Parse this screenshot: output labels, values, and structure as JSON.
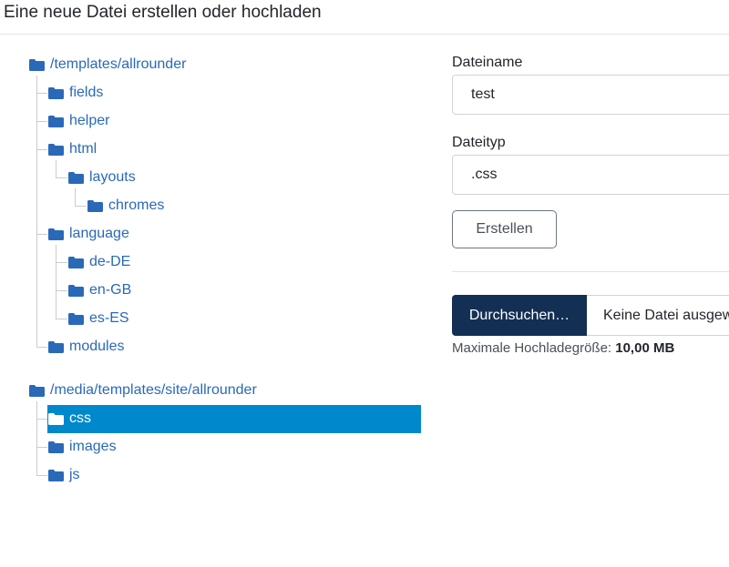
{
  "header": {
    "title": "Eine neue Datei erstellen oder hochladen"
  },
  "tree": {
    "roots": [
      {
        "label": "/templates/allrounder",
        "children": [
          {
            "label": "fields"
          },
          {
            "label": "helper"
          },
          {
            "label": "html",
            "children": [
              {
                "label": "layouts",
                "children": [
                  {
                    "label": "chromes"
                  }
                ]
              }
            ]
          },
          {
            "label": "language",
            "children": [
              {
                "label": "de-DE"
              },
              {
                "label": "en-GB"
              },
              {
                "label": "es-ES"
              }
            ]
          },
          {
            "label": "modules"
          }
        ]
      },
      {
        "label": "/media/templates/site/allrounder",
        "children": [
          {
            "label": "css",
            "selected": true
          },
          {
            "label": "images"
          },
          {
            "label": "js"
          }
        ]
      }
    ]
  },
  "form": {
    "filename_label": "Dateiname",
    "filename_value": "test",
    "filetype_label": "Dateityp",
    "filetype_value": ".css",
    "create_button": "Erstellen",
    "browse_button": "Durchsuchen…",
    "no_file_text": "Keine Datei ausgewählt.",
    "max_upload_label": "Maximale Hochladegröße:",
    "max_upload_value": "10,00 MB"
  },
  "colors": {
    "selected_bg": "#0088cc",
    "folder_icon": "#2a69b8",
    "browse_bg": "#132f53"
  }
}
